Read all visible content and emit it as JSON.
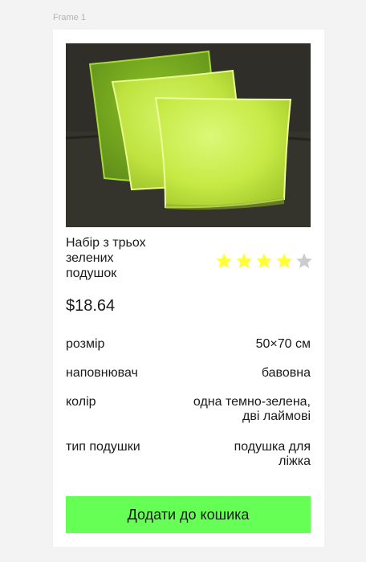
{
  "frame": {
    "label": "Frame 1"
  },
  "product": {
    "image_alt": "Набір з трьох зелених подушок",
    "title": "Набір з трьох\nзелених\nподушок",
    "rating": 4,
    "rating_max": 5,
    "price": "$18.64"
  },
  "specs": [
    {
      "label": "розмір",
      "value": "50×70 см"
    },
    {
      "label": "наповнювач",
      "value": "бавовна"
    },
    {
      "label": "колір",
      "value": "одна темно-зелена,\nдві лаймові"
    },
    {
      "label": "тип подушки",
      "value": "подушка для\nліжка"
    }
  ],
  "cart_button": {
    "label": "Додати до кошика"
  },
  "colors": {
    "button": "#66ff55",
    "star_filled": "#ffff33",
    "star_empty": "#cccccc"
  }
}
